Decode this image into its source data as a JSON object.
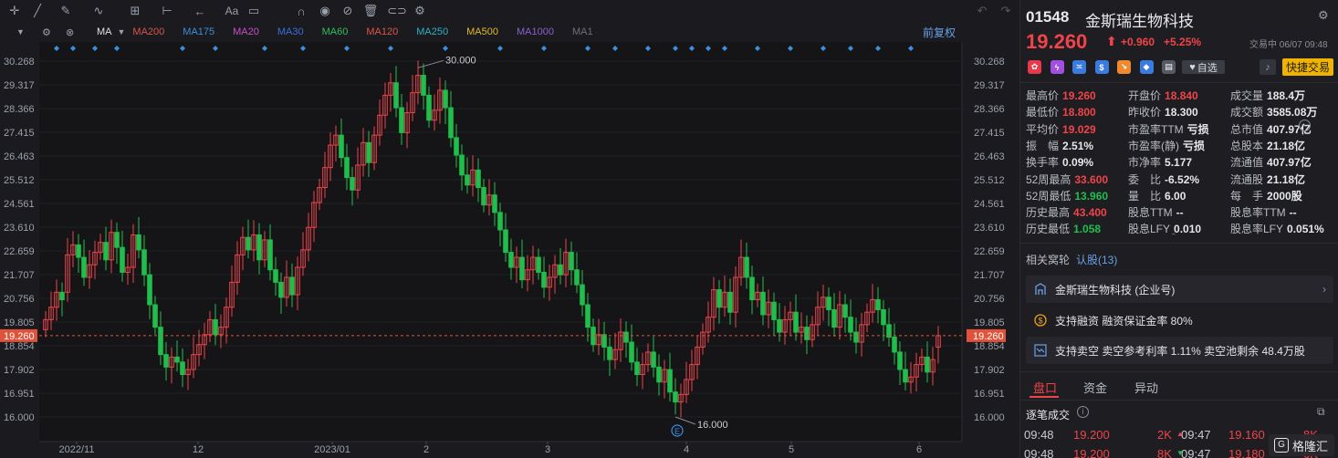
{
  "toolbar": {
    "icons": [
      "crosshair-icon",
      "line-tool-icon",
      "pen-tool-icon",
      "wave-tool-icon",
      "fib-tool-icon",
      "measure-tool-icon",
      "arrow-tool-icon",
      "text-tool-icon",
      "comment-tool-icon",
      "magnet-icon",
      "eye-icon",
      "hide-icon",
      "trash-icon",
      "link-icon",
      "settings-icon"
    ],
    "undo_icon": "undo-icon",
    "redo_icon": "redo-icon"
  },
  "ma_bar": {
    "indicator": "MA",
    "items": [
      {
        "label": "MA200",
        "color": "#d9534f"
      },
      {
        "label": "MA175",
        "color": "#3a8fd9"
      },
      {
        "label": "MA20",
        "color": "#c84fc8"
      },
      {
        "label": "MA30",
        "color": "#3a6fd9"
      },
      {
        "label": "MA60",
        "color": "#2fbf5a"
      },
      {
        "label": "MA120",
        "color": "#e0534a"
      },
      {
        "label": "MA250",
        "color": "#2bb3c7"
      },
      {
        "label": "MA500",
        "color": "#e0b82e"
      },
      {
        "label": "MA1000",
        "color": "#8b5fd0"
      },
      {
        "label": "MA1",
        "color": "#6b6f78"
      }
    ],
    "adjust_label": "前复权"
  },
  "chart_data": {
    "type": "candlestick",
    "y_ticks": [
      "30.268",
      "29.317",
      "28.366",
      "27.415",
      "26.463",
      "25.512",
      "24.561",
      "23.610",
      "22.659",
      "21.707",
      "20.756",
      "19.805",
      "18.854",
      "17.902",
      "16.951",
      "16.000"
    ],
    "ylim": [
      16.0,
      30.268
    ],
    "x_ticks": [
      "2022/11",
      "12",
      "2023/01",
      "2",
      "3",
      "4",
      "5",
      "6"
    ],
    "current_price": "19.260",
    "high_marker": "30.000",
    "low_marker": "16.000",
    "event_marker": "E",
    "colors": {
      "up": "#f0444a",
      "down": "#1fbf4c",
      "marker": "#3a8fe0"
    },
    "close": [
      19.9,
      20.4,
      21.0,
      20.7,
      22.5,
      22.9,
      22.4,
      21.6,
      22.1,
      22.6,
      23.0,
      22.3,
      23.4,
      22.8,
      21.8,
      22.0,
      23.3,
      22.7,
      21.7,
      20.5,
      19.6,
      18.5,
      18.0,
      18.4,
      18.2,
      17.7,
      17.9,
      18.5,
      18.9,
      19.3,
      19.9,
      19.3,
      19.6,
      20.4,
      21.4,
      22.5,
      23.2,
      22.7,
      23.3,
      22.3,
      23.1,
      21.9,
      21.4,
      20.8,
      21.6,
      20.9,
      22.0,
      22.7,
      23.6,
      24.6,
      25.2,
      26.0,
      26.9,
      27.3,
      26.4,
      25.6,
      25.1,
      26.1,
      27.0,
      26.2,
      27.3,
      28.1,
      28.9,
      29.4,
      28.4,
      27.4,
      28.2,
      29.0,
      29.7,
      28.9,
      27.9,
      28.3,
      29.1,
      28.4,
      27.2,
      26.5,
      25.7,
      25.3,
      25.9,
      25.2,
      24.5,
      24.9,
      24.2,
      23.5,
      22.6,
      22.0,
      22.4,
      21.5,
      21.9,
      22.4,
      21.8,
      21.2,
      21.6,
      22.1,
      21.7,
      22.6,
      21.9,
      21.3,
      20.5,
      19.6,
      18.9,
      19.3,
      18.8,
      18.3,
      18.7,
      19.4,
      19.0,
      18.2,
      17.7,
      18.1,
      18.6,
      18.0,
      17.4,
      17.9,
      17.0,
      16.6,
      16.9,
      17.5,
      18.1,
      18.8,
      19.4,
      20.0,
      21.1,
      20.4,
      21.0,
      20.2,
      21.6,
      22.4,
      21.6,
      20.7,
      21.0,
      20.1,
      20.6,
      19.9,
      19.4,
      19.9,
      20.2,
      19.4,
      19.6,
      19.1,
      19.7,
      20.4,
      20.8,
      20.3,
      19.6,
      20.5,
      20.0,
      19.4,
      19.0,
      19.7,
      20.2,
      20.7,
      20.3,
      19.7,
      19.2,
      18.6,
      17.9,
      17.4,
      17.6,
      18.1,
      18.4,
      17.8,
      18.3,
      19.26
    ],
    "open": [
      19.5,
      19.9,
      20.4,
      21.0,
      21.0,
      22.5,
      22.9,
      22.4,
      21.6,
      22.1,
      22.6,
      23.0,
      22.3,
      23.4,
      22.8,
      21.8,
      22.0,
      23.3,
      22.7,
      21.7,
      20.5,
      19.6,
      18.5,
      18.0,
      18.4,
      18.2,
      17.7,
      17.9,
      18.5,
      18.9,
      19.3,
      19.9,
      19.3,
      19.6,
      20.4,
      21.4,
      22.5,
      23.2,
      22.7,
      23.3,
      22.3,
      23.1,
      21.9,
      21.4,
      20.8,
      21.6,
      20.9,
      22.0,
      22.7,
      23.6,
      24.6,
      25.2,
      26.0,
      26.9,
      27.3,
      26.4,
      25.6,
      25.1,
      26.1,
      27.0,
      26.2,
      27.3,
      28.1,
      28.9,
      29.4,
      28.4,
      27.4,
      28.2,
      29.0,
      29.7,
      28.9,
      27.9,
      28.3,
      29.1,
      28.4,
      27.2,
      26.5,
      25.7,
      25.3,
      25.9,
      25.2,
      24.5,
      24.9,
      24.2,
      23.5,
      22.6,
      22.0,
      22.4,
      21.5,
      21.9,
      22.4,
      21.8,
      21.2,
      21.6,
      22.1,
      21.7,
      22.6,
      21.9,
      21.3,
      20.5,
      19.6,
      18.9,
      19.3,
      18.8,
      18.3,
      18.7,
      19.4,
      19.0,
      18.2,
      17.7,
      18.1,
      18.6,
      18.0,
      17.4,
      17.9,
      17.0,
      16.6,
      16.9,
      17.5,
      18.1,
      18.8,
      19.4,
      20.0,
      21.1,
      20.4,
      21.0,
      20.2,
      21.6,
      22.4,
      21.6,
      20.7,
      21.0,
      20.1,
      20.6,
      19.9,
      19.4,
      19.9,
      20.2,
      19.4,
      19.6,
      19.1,
      19.7,
      20.4,
      20.8,
      20.3,
      19.6,
      20.5,
      20.0,
      19.4,
      19.0,
      19.7,
      20.2,
      20.7,
      20.3,
      19.7,
      19.2,
      18.6,
      17.9,
      17.4,
      17.6,
      18.1,
      18.4,
      17.8,
      18.8
    ],
    "dividend_marker_indices": [
      2,
      5,
      9,
      13,
      25,
      31,
      40,
      47,
      55,
      63,
      73,
      83,
      91,
      99,
      104,
      110,
      115,
      118,
      121,
      124,
      130,
      136,
      142,
      147,
      152,
      158
    ]
  },
  "quote": {
    "code": "01548",
    "name": "金斯瑞生物科技",
    "price": "19.260",
    "change": "+0.960",
    "change_pct": "+5.25%",
    "status": "交易中 06/07 09:48",
    "watch_label": "自选",
    "quick_trade": "快捷交易",
    "market_icons": [
      {
        "name": "hk-flag-icon",
        "glyph": "✿",
        "color": "#e6394a"
      },
      {
        "name": "stock-connect-icon",
        "glyph": "ϟ",
        "color": "#a04fe0"
      },
      {
        "name": "margin-icon",
        "glyph": "≍",
        "color": "#3a7be0"
      },
      {
        "name": "dollar-icon",
        "glyph": "$",
        "color": "#3a7be0"
      },
      {
        "name": "short-sell-icon",
        "glyph": "↘",
        "color": "#f08a2e"
      },
      {
        "name": "tag-icon",
        "glyph": "◆",
        "color": "#3a7be0"
      },
      {
        "name": "doc-icon",
        "glyph": "▤",
        "color": "#555a64"
      }
    ],
    "fields": [
      [
        {
          "label": "最高价",
          "value": "19.260",
          "c": "red"
        },
        {
          "label": "开盘价",
          "value": "18.840",
          "c": "red"
        },
        {
          "label": "成交量",
          "value": "188.4万",
          "c": "white"
        }
      ],
      [
        {
          "label": "最低价",
          "value": "18.800",
          "c": "red"
        },
        {
          "label": "昨收价",
          "value": "18.300",
          "c": "white"
        },
        {
          "label": "成交额",
          "value": "3585.08万",
          "c": "white"
        }
      ],
      [
        {
          "label": "平均价",
          "value": "19.029",
          "c": "red"
        },
        {
          "label": "市盈率TTM",
          "value": "亏损",
          "c": "white"
        },
        {
          "label": "总市值",
          "value": "407.97亿",
          "c": "white"
        }
      ],
      [
        {
          "label": "振　幅",
          "value": "2.51%",
          "c": "white"
        },
        {
          "label": "市盈率(静)",
          "value": "亏损",
          "c": "white"
        },
        {
          "label": "总股本",
          "value": "21.18亿",
          "c": "white"
        }
      ],
      [
        {
          "label": "换手率",
          "value": "0.09%",
          "c": "white"
        },
        {
          "label": "市净率",
          "value": "5.177",
          "c": "white"
        },
        {
          "label": "流通值",
          "value": "407.97亿",
          "c": "white"
        }
      ],
      [
        {
          "label": "52周最高",
          "value": "33.600",
          "c": "red"
        },
        {
          "label": "委　比",
          "value": "-6.52%",
          "c": "white"
        },
        {
          "label": "流通股",
          "value": "21.18亿",
          "c": "white"
        }
      ],
      [
        {
          "label": "52周最低",
          "value": "13.960",
          "c": "green"
        },
        {
          "label": "量　比",
          "value": "6.00",
          "c": "white"
        },
        {
          "label": "每　手",
          "value": "2000股",
          "c": "white"
        }
      ],
      [
        {
          "label": "历史最高",
          "value": "43.400",
          "c": "red"
        },
        {
          "label": "股息TTM",
          "value": "--",
          "c": "white"
        },
        {
          "label": "股息率TTM",
          "value": "--",
          "c": "white"
        }
      ],
      [
        {
          "label": "历史最低",
          "value": "1.058",
          "c": "green"
        },
        {
          "label": "股息LFY",
          "value": "0.010",
          "c": "white"
        },
        {
          "label": "股息率LFY",
          "value": "0.051%",
          "c": "white"
        }
      ]
    ],
    "related_label": "相关窝轮",
    "warrant_label": "认股(13)",
    "company_row": "金斯瑞生物科技 (企业号)",
    "margin_row": "支持融资  融资保证金率 80%",
    "short_row": "支持卖空  卖空参考利率 1.11% 卖空池剩余 48.4万股",
    "tabs": [
      "盘口",
      "资金",
      "异动"
    ],
    "ticks_title": "逐笔成交",
    "trades": [
      {
        "t1": "09:48",
        "p1": "19.200",
        "v1": "2K",
        "t2": "09:47",
        "p2": "19.160",
        "v2": "8K"
      },
      {
        "t1": "09:48",
        "p1": "19.200",
        "v1": "8K",
        "t2": "09:47",
        "p2": "19.180",
        "v2": "6K"
      }
    ],
    "brand": "格隆汇"
  }
}
